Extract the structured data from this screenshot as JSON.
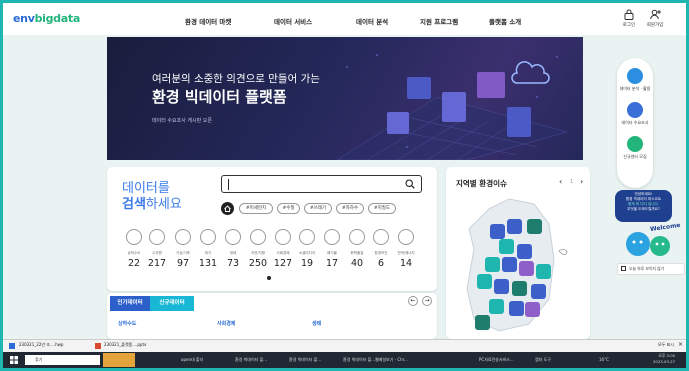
{
  "logo": {
    "part1": "env",
    "part2": "bigdata"
  },
  "nav": {
    "items": [
      "환경 데이터 마켓",
      "데이터 서비스",
      "데이터 분석",
      "지원 프로그램",
      "플랫폼 소개"
    ]
  },
  "header_actions": {
    "login": "로그인",
    "signup": "회원가입"
  },
  "hero": {
    "line1": "여러분의 소중한 의견으로 만들어 가는",
    "line2": "환경 빅데이터 플랫폼",
    "sub": "데이터 수요조사 게시판 오픈"
  },
  "quick_menu": {
    "items": [
      "데이터 분석 · 활용",
      "데이터 수요조사",
      "신규센터 모집"
    ]
  },
  "search": {
    "title1": "데이터를",
    "title2a": "검색",
    "title2b": "하세요",
    "tags": [
      "#미세먼지",
      "#수질",
      "#쓰레기",
      "#자하수",
      "#지질도"
    ]
  },
  "categories": [
    {
      "label": "상하수도",
      "count": "22"
    },
    {
      "label": "수자원",
      "count": "217"
    },
    {
      "label": "기상/기후",
      "count": "97"
    },
    {
      "label": "대기",
      "count": "131"
    },
    {
      "label": "생태",
      "count": "73"
    },
    {
      "label": "자연/지형",
      "count": "250"
    },
    {
      "label": "사회경제",
      "count": "127"
    },
    {
      "label": "소셜미디어",
      "count": "19"
    },
    {
      "label": "폐기물",
      "count": "17"
    },
    {
      "label": "화학물질",
      "count": "40"
    },
    {
      "label": "환경보건",
      "count": "6"
    },
    {
      "label": "전력/에너지",
      "count": "14"
    }
  ],
  "tabs": {
    "popular": "인기데이터",
    "new": "신규데이터"
  },
  "news": [
    "상하수도",
    "사회경제",
    "생태"
  ],
  "regional": {
    "title": "지역별 환경이슈",
    "pager": "1"
  },
  "mascot_bubble": {
    "line1": "안녕하세요!",
    "line2": "환경 빅데이터 마스코트",
    "line3": "뭉게 와 디디 입니다.",
    "line4": "무엇을 도와드릴까요?",
    "welcome": "Welcome"
  },
  "popup_check": "오늘 하루 보이지 않기",
  "downloads": {
    "file1": "230321_22년 조....hwp",
    "file2": "230321_플랫폼....pptx",
    "show_all": "모두 표시"
  },
  "taskbar": {
    "search": "찾기",
    "apps": [
      "open대 폴더",
      "환경 빅데이터 플...",
      "환경 빅데이터 플...",
      "환경 빅데이터 플...",
      "웹메일보기 - Chr...",
      "PC자료전송서비스...",
      "캡처 도구"
    ],
    "temp": "16°C",
    "time": "오후 3:05",
    "date": "2023-03-27"
  },
  "colors": {
    "brand_blue": "#2b6cd8",
    "brand_green": "#22b57a",
    "teal": "#1fb6b0",
    "tab_red": "#2c5fc9",
    "tab_cyan": "#19b7d6"
  }
}
